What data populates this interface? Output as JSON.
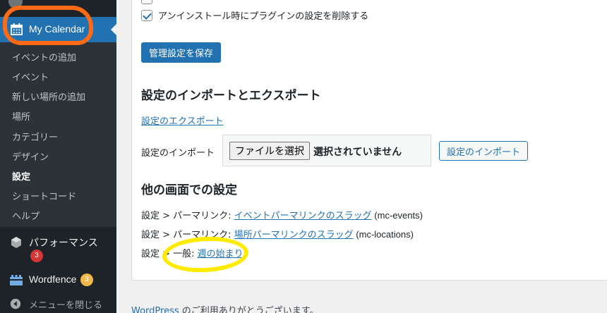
{
  "sidebar": {
    "active_menu": "My Calendar",
    "submenu": [
      "イベントの追加",
      "イベント",
      "新しい場所の追加",
      "場所",
      "カテゴリー",
      "デザイン",
      "設定",
      "ショートコード",
      "ヘルプ"
    ],
    "current_submenu": "設定",
    "performance": {
      "label": "パフォーマンス",
      "badge": "3"
    },
    "wordfence": {
      "label": "Wordfence",
      "badge": "3"
    },
    "collapse": "メニューを閉じる"
  },
  "main": {
    "uninstall_checkbox": "アンインストール時にプラグインの設定を削除する",
    "save_button": "管理設定を保存",
    "import_export_heading": "設定のインポートとエクスポート",
    "export_link": "設定のエクスポート",
    "import_label": "設定のインポート",
    "file_button": "ファイルを選択",
    "file_status": "選択されていません",
    "import_button": "設定のインポート",
    "other_heading": "他の画面での設定",
    "settings": [
      {
        "prefix": "設定 > パーマリンク: ",
        "link": "イベントパーマリンクのスラッグ",
        "suffix": " (mc-events)"
      },
      {
        "prefix": "設定 > パーマリンク: ",
        "link": "場所パーマリンクのスラッグ",
        "suffix": " (mc-locations)"
      },
      {
        "prefix": "設定 > 一般: ",
        "link": "週の始まり",
        "suffix": ""
      }
    ]
  },
  "footer": {
    "link": "WordPress",
    "text": " のご利用ありがとうございます。"
  },
  "colors": {
    "accent": "#2271b1",
    "sidebar": "#1d2327",
    "annotation_orange": "#ff6a16",
    "annotation_yellow": "#ffeb00"
  }
}
